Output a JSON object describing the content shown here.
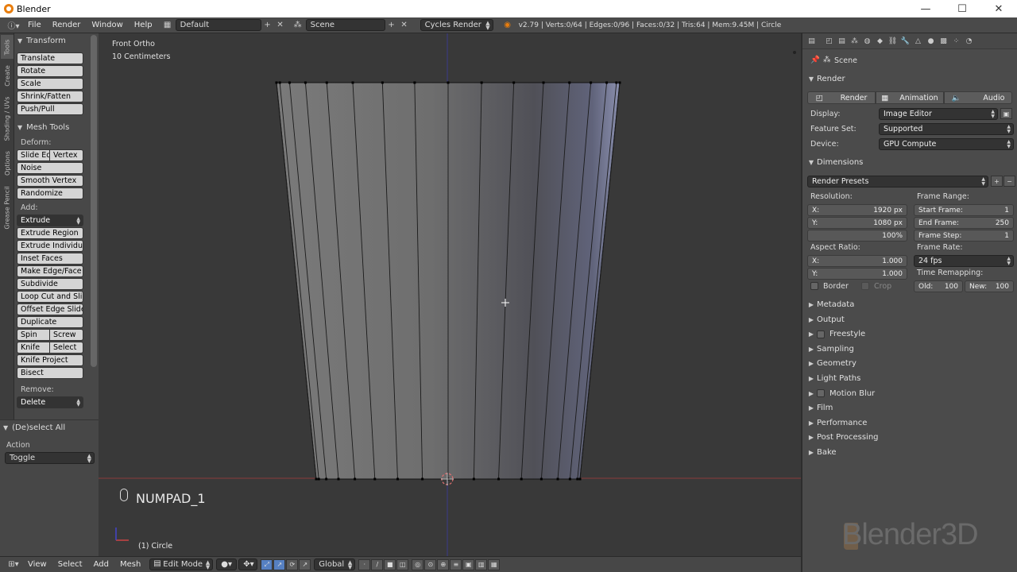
{
  "window": {
    "title": "Blender",
    "minimize": "—",
    "maximize": "☐",
    "close": "✕"
  },
  "infobar": {
    "menus": [
      "File",
      "Render",
      "Window",
      "Help"
    ],
    "layout": "Default",
    "scene": "Scene",
    "engine": "Cycles Render",
    "stats": "v2.79 | Verts:0/64 | Edges:0/96 | Faces:0/32 | Tris:64 | Mem:9.45M | Circle"
  },
  "tabstrip": [
    "Tools",
    "Create",
    "Shading / UVs",
    "Options",
    "Grease Pencil"
  ],
  "toolshelf": {
    "transform": {
      "title": "Transform",
      "buttons": [
        "Translate",
        "Rotate",
        "Scale",
        "Shrink/Fatten",
        "Push/Pull"
      ]
    },
    "mesh_tools": {
      "title": "Mesh Tools",
      "deform_label": "Deform:",
      "deform_row": [
        "Slide Ed",
        "Vertex"
      ],
      "deform_buttons": [
        "Noise",
        "Smooth Vertex",
        "Randomize"
      ],
      "add_label": "Add:",
      "extrude": "Extrude",
      "add_buttons_1": [
        "Extrude Region",
        "Extrude Individual",
        "Inset Faces",
        "Make Edge/Face",
        "Subdivide",
        "Loop Cut and Sli...",
        "Offset Edge Slide",
        "Duplicate"
      ],
      "row_spin": [
        "Spin",
        "Screw"
      ],
      "row_knife": [
        "Knife",
        "Select"
      ],
      "add_buttons_2": [
        "Knife Project",
        "Bisect"
      ],
      "remove_label": "Remove:",
      "delete": "Delete"
    }
  },
  "operator": {
    "title": "(De)select All",
    "action_label": "Action",
    "action_value": "Toggle"
  },
  "viewport": {
    "view_name": "Front Ortho",
    "scale": "10 Centimeters",
    "key_hint": "NUMPAD_1",
    "object": "(1) Circle"
  },
  "view_header": {
    "menus": [
      "View",
      "Select",
      "Add",
      "Mesh"
    ],
    "mode": "Edit Mode",
    "orientation": "Global"
  },
  "properties": {
    "scene_path": "Scene",
    "render_panel": "Render",
    "render_buttons": [
      "Render",
      "Animation",
      "Audio"
    ],
    "display_label": "Display:",
    "display_value": "Image Editor",
    "feature_label": "Feature Set:",
    "feature_value": "Supported",
    "device_label": "Device:",
    "device_value": "GPU Compute",
    "dimensions_panel": "Dimensions",
    "presets": "Render Presets",
    "resolution_label": "Resolution:",
    "res_x_label": "X:",
    "res_x": "1920 px",
    "res_y_label": "Y:",
    "res_y": "1080 px",
    "res_pct": "100%",
    "frame_range_label": "Frame Range:",
    "start_label": "Start Frame:",
    "start": "1",
    "end_label": "End Frame:",
    "end": "250",
    "step_label": "Frame Step:",
    "step": "1",
    "aspect_label": "Aspect Ratio:",
    "asp_x_label": "X:",
    "asp_x": "1.000",
    "asp_y_label": "Y:",
    "asp_y": "1.000",
    "frame_rate_label": "Frame Rate:",
    "frame_rate": "24 fps",
    "time_remap_label": "Time Remapping:",
    "old_label": "Old:",
    "old": "100",
    "new_label": "New:",
    "new": "100",
    "border": "Border",
    "crop": "Crop",
    "sections": [
      {
        "label": "Metadata",
        "checkbox": false
      },
      {
        "label": "Output",
        "checkbox": false
      },
      {
        "label": "Freestyle",
        "checkbox": true
      },
      {
        "label": "Sampling",
        "checkbox": false
      },
      {
        "label": "Geometry",
        "checkbox": false
      },
      {
        "label": "Light Paths",
        "checkbox": false
      },
      {
        "label": "Motion Blur",
        "checkbox": true
      },
      {
        "label": "Film",
        "checkbox": false
      },
      {
        "label": "Performance",
        "checkbox": false
      },
      {
        "label": "Post Processing",
        "checkbox": false
      },
      {
        "label": "Bake",
        "checkbox": false
      }
    ],
    "watermark": "Blender3D"
  }
}
